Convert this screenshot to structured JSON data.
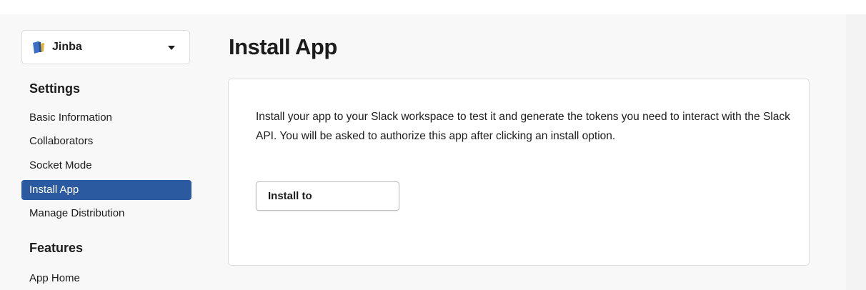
{
  "app_selector": {
    "name": "Jinba",
    "icon": "app-logo-icon"
  },
  "sidebar": {
    "sections": [
      {
        "title": "Settings",
        "items": [
          {
            "label": "Basic Information",
            "active": false
          },
          {
            "label": "Collaborators",
            "active": false
          },
          {
            "label": "Socket Mode",
            "active": false
          },
          {
            "label": "Install App",
            "active": true
          },
          {
            "label": "Manage Distribution",
            "active": false
          }
        ]
      },
      {
        "title": "Features",
        "items": [
          {
            "label": "App Home",
            "active": false
          }
        ]
      }
    ]
  },
  "main": {
    "title": "Install App",
    "card": {
      "description": "Install your app to your Slack workspace to test it and generate the tokens you need to interact with the Slack API. You will be asked to authorize this app after clicking an install option.",
      "button_label": "Install to"
    }
  },
  "colors": {
    "accent": "#2c5aa0",
    "background": "#f8f8f8",
    "card": "#ffffff"
  }
}
